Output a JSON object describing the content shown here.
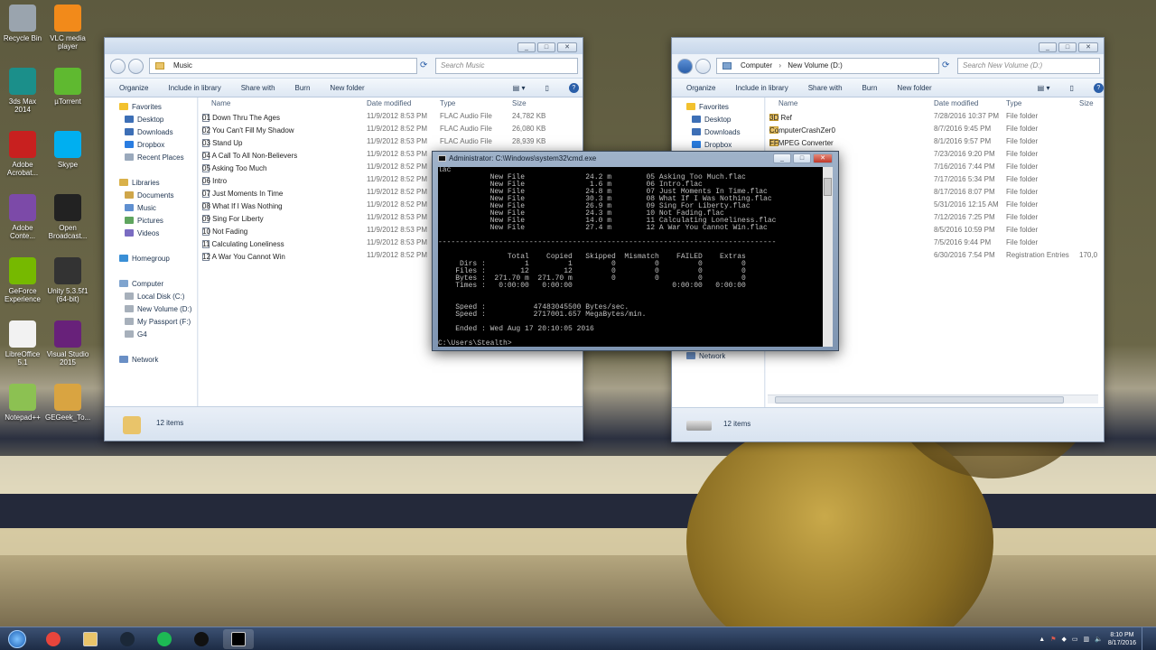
{
  "desktop_icons": [
    {
      "label": "Recycle Bin",
      "icon": "recycle-bin-icon",
      "color": "#9aa4ae"
    },
    {
      "label": "VLC media player",
      "icon": "vlc-icon",
      "color": "#f28a1a"
    },
    {
      "label": "3ds Max 2014",
      "icon": "3dsmax-icon",
      "color": "#1b8f8a"
    },
    {
      "label": "µTorrent",
      "icon": "utorrent-icon",
      "color": "#5fb930"
    },
    {
      "label": "Adobe Acrobat...",
      "icon": "acrobat-icon",
      "color": "#c8201f"
    },
    {
      "label": "Skype",
      "icon": "skype-icon",
      "color": "#00aff0"
    },
    {
      "label": "Adobe Conte...",
      "icon": "adobe-content-icon",
      "color": "#7c4aa8"
    },
    {
      "label": "Open Broadcast...",
      "icon": "obs-icon",
      "color": "#222222"
    },
    {
      "label": "GeForce Experience",
      "icon": "geforce-icon",
      "color": "#76b900"
    },
    {
      "label": "Unity 5.3.5f1 (64-bit)",
      "icon": "unity-icon",
      "color": "#333333"
    },
    {
      "label": "LibreOffice 5.1",
      "icon": "libreoffice-icon",
      "color": "#f2f2f2"
    },
    {
      "label": "Visual Studio 2015",
      "icon": "visual-studio-icon",
      "color": "#68217a"
    },
    {
      "label": "Notepad++",
      "icon": "notepadpp-icon",
      "color": "#8cc152"
    },
    {
      "label": "GEGeek_To...",
      "icon": "archive-icon",
      "color": "#d9a441"
    }
  ],
  "left_window": {
    "address": "Music",
    "search_placeholder": "Search Music",
    "toolbar": [
      "Organize",
      "Include in library",
      "Share with",
      "Burn",
      "New folder"
    ],
    "nav": [
      {
        "label": "Favorites",
        "icon": "star-icon",
        "indent": 0
      },
      {
        "label": "Desktop",
        "icon": "desktop-icon",
        "indent": 1
      },
      {
        "label": "Downloads",
        "icon": "downloads-icon",
        "indent": 1
      },
      {
        "label": "Dropbox",
        "icon": "dropbox-icon",
        "indent": 1
      },
      {
        "label": "Recent Places",
        "icon": "recent-places-icon",
        "indent": 1
      },
      {
        "label": "",
        "icon": "",
        "indent": 0
      },
      {
        "label": "Libraries",
        "icon": "libraries-icon",
        "indent": 0
      },
      {
        "label": "Documents",
        "icon": "documents-icon",
        "indent": 1
      },
      {
        "label": "Music",
        "icon": "music-icon",
        "indent": 1
      },
      {
        "label": "Pictures",
        "icon": "pictures-icon",
        "indent": 1
      },
      {
        "label": "Videos",
        "icon": "videos-icon",
        "indent": 1
      },
      {
        "label": "",
        "icon": "",
        "indent": 0
      },
      {
        "label": "Homegroup",
        "icon": "homegroup-icon",
        "indent": 0
      },
      {
        "label": "",
        "icon": "",
        "indent": 0
      },
      {
        "label": "Computer",
        "icon": "computer-icon",
        "indent": 0
      },
      {
        "label": "Local Disk (C:)",
        "icon": "drive-icon",
        "indent": 1
      },
      {
        "label": "New Volume (D:)",
        "icon": "drive-icon",
        "indent": 1
      },
      {
        "label": "My Passport (F:)",
        "icon": "drive-icon",
        "indent": 1
      },
      {
        "label": "G4",
        "icon": "drive-icon",
        "indent": 1
      },
      {
        "label": "",
        "icon": "",
        "indent": 0
      },
      {
        "label": "Network",
        "icon": "network-icon",
        "indent": 0
      }
    ],
    "columns": [
      "Name",
      "Date modified",
      "Type",
      "Size"
    ],
    "files": [
      {
        "name": "01 Down Thru The Ages",
        "date": "11/9/2012 8:53 PM",
        "type": "FLAC Audio File",
        "size": "24,782 KB"
      },
      {
        "name": "02 You Can't Fill My Shadow",
        "date": "11/9/2012 8:52 PM",
        "type": "FLAC Audio File",
        "size": "26,080 KB"
      },
      {
        "name": "03 Stand Up",
        "date": "11/9/2012 8:53 PM",
        "type": "FLAC Audio File",
        "size": "28,939 KB"
      },
      {
        "name": "04 A Call To All Non-Believers",
        "date": "11/9/2012 8:53 PM",
        "type": "",
        "size": ""
      },
      {
        "name": "05 Asking Too Much",
        "date": "11/9/2012 8:52 PM",
        "type": "",
        "size": ""
      },
      {
        "name": "06 Intro",
        "date": "11/9/2012 8:52 PM",
        "type": "",
        "size": ""
      },
      {
        "name": "07 Just Moments In Time",
        "date": "11/9/2012 8:52 PM",
        "type": "",
        "size": ""
      },
      {
        "name": "08 What If I Was Nothing",
        "date": "11/9/2012 8:52 PM",
        "type": "",
        "size": ""
      },
      {
        "name": "09 Sing For Liberty",
        "date": "11/9/2012 8:53 PM",
        "type": "",
        "size": ""
      },
      {
        "name": "10 Not Fading",
        "date": "11/9/2012 8:53 PM",
        "type": "",
        "size": ""
      },
      {
        "name": "11 Calculating Loneliness",
        "date": "11/9/2012 8:53 PM",
        "type": "",
        "size": ""
      },
      {
        "name": "12 A War You Cannot Win",
        "date": "11/9/2012 8:52 PM",
        "type": "",
        "size": ""
      }
    ],
    "status": "12 items"
  },
  "right_window": {
    "address": [
      "Computer",
      "New Volume (D:)"
    ],
    "search_placeholder": "Search New Volume (D:)",
    "toolbar": [
      "Organize",
      "Include in library",
      "Share with",
      "Burn",
      "New folder"
    ],
    "nav": [
      {
        "label": "Favorites",
        "icon": "star-icon",
        "indent": 0
      },
      {
        "label": "Desktop",
        "icon": "desktop-icon",
        "indent": 1
      },
      {
        "label": "Downloads",
        "icon": "downloads-icon",
        "indent": 1
      },
      {
        "label": "Dropbox",
        "icon": "dropbox-icon",
        "indent": 1
      }
    ],
    "nav_bottom": "Network",
    "columns": [
      "Name",
      "Date modified",
      "Type",
      "Size"
    ],
    "files": [
      {
        "name": "3D Ref",
        "date": "7/28/2016 10:37 PM",
        "type": "File folder",
        "size": ""
      },
      {
        "name": "ComputerCrashZer0",
        "date": "8/7/2016 9:45 PM",
        "type": "File folder",
        "size": ""
      },
      {
        "name": "FFMPEG Converter",
        "date": "8/1/2016 9:57 PM",
        "type": "File folder",
        "size": ""
      },
      {
        "name": "",
        "date": "7/23/2016 9:20 PM",
        "type": "File folder",
        "size": ""
      },
      {
        "name": "opment Project Work",
        "date": "7/16/2016 7:44 PM",
        "type": "File folder",
        "size": ""
      },
      {
        "name": "",
        "date": "7/17/2016 5:34 PM",
        "type": "File folder",
        "size": ""
      },
      {
        "name": "",
        "date": "8/17/2016 8:07 PM",
        "type": "File folder",
        "size": ""
      },
      {
        "name": "",
        "date": "5/31/2016 12:15 AM",
        "type": "File folder",
        "size": ""
      },
      {
        "name": "",
        "date": "7/12/2016 7:25 PM",
        "type": "File folder",
        "size": ""
      },
      {
        "name": "",
        "date": "8/5/2016 10:59 PM",
        "type": "File folder",
        "size": ""
      },
      {
        "name": "",
        "date": "7/5/2016 9:44 PM",
        "type": "File folder",
        "size": ""
      },
      {
        "name": "",
        "date": "6/30/2016 7:54 PM",
        "type": "Registration Entries",
        "size": "170,0"
      }
    ],
    "status": "12 items"
  },
  "cmd": {
    "title": "Administrator: C:\\Windows\\system32\\cmd.exe",
    "lines": [
      "lac",
      "            New File              24.2 m        05 Asking Too Much.flac",
      "            New File               1.6 m        06 Intro.flac",
      "            New File              24.8 m        07 Just Moments In Time.flac",
      "            New File              30.3 m        08 What If I Was Nothing.flac",
      "            New File              26.9 m        09 Sing For Liberty.flac",
      "            New File              24.3 m        10 Not Fading.flac",
      "            New File              14.0 m        11 Calculating Loneliness.flac",
      "            New File              27.4 m        12 A War You Cannot Win.flac",
      "",
      "------------------------------------------------------------------------------",
      "",
      "                Total    Copied   Skipped  Mismatch    FAILED    Extras",
      "     Dirs :         1         1         0         0         0         0",
      "    Files :        12        12         0         0         0         0",
      "    Bytes :  271.70 m  271.70 m         0         0         0         0",
      "    Times :   0:00:00   0:00:00                       0:00:00   0:00:00",
      "",
      "",
      "    Speed :           47483045500 Bytes/sec.",
      "    Speed :           2717001.657 MegaBytes/min.",
      "",
      "    Ended : Wed Aug 17 20:10:05 2016",
      "",
      "C:\\Users\\Stealth>"
    ]
  },
  "taskbar": {
    "apps": [
      {
        "name": "chrome-icon",
        "color": "#e8453c"
      },
      {
        "name": "explorer-icon",
        "color": "#e9c46a"
      },
      {
        "name": "steam-icon",
        "color": "#1b2838"
      },
      {
        "name": "spotify-icon",
        "color": "#1db954"
      },
      {
        "name": "obs-icon",
        "color": "#111111"
      },
      {
        "name": "cmd-icon",
        "color": "#000000"
      }
    ],
    "time": "8:10 PM",
    "date": "8/17/2016"
  }
}
